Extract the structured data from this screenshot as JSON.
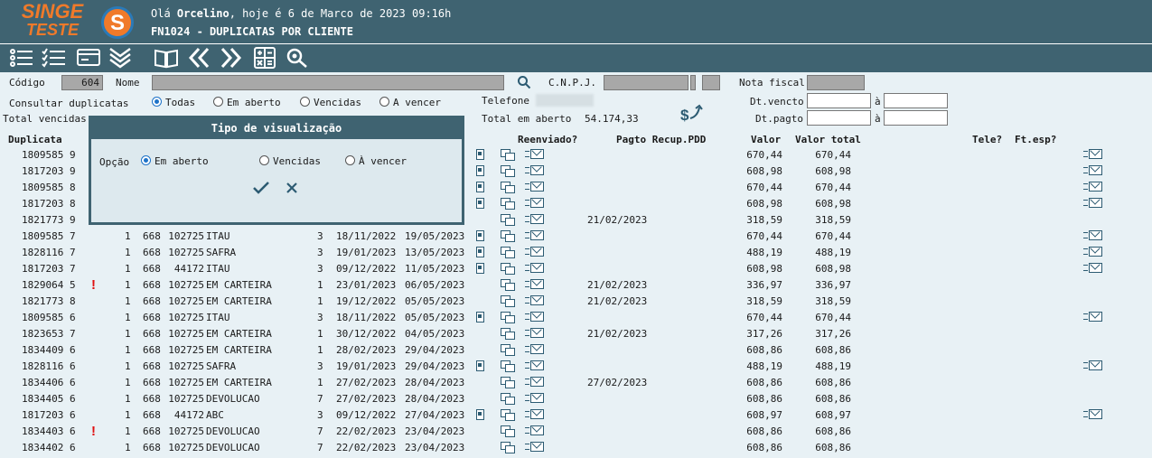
{
  "header": {
    "logo_main": "SINGE",
    "logo_sub": "TESTE",
    "logo_letter": "S",
    "greeting_prefix": "Olá ",
    "user": "Orcelino",
    "greeting_suffix": ", hoje é 6 de Marco de 2023 09:16h",
    "screen_title": "FN1024 - DUPLICATAS POR CLIENTE"
  },
  "toolbar_icons": [
    "list-icon",
    "checklist-icon",
    "card-icon",
    "chevrons-down-icon",
    "book-icon",
    "previous-icon",
    "next-icon",
    "calculator-icon",
    "search-icon"
  ],
  "filters": {
    "codigo_label": "Código",
    "codigo_value": "604",
    "nome_label": "Nome",
    "cnpj_label": "C.N.P.J.",
    "nota_fiscal_label": "Nota fiscal",
    "consultar_label": "Consultar duplicatas",
    "opts": [
      "Todas",
      "Em aberto",
      "Vencidas",
      "A vencer"
    ],
    "selected": "Todas",
    "telefone_label": "Telefone",
    "dt_vencto_label": "Dt.vencto",
    "dt_pagto_label": "Dt.pagto",
    "a_label": "à",
    "total_vencidas_label": "Total vencidas",
    "total_aberto_label": "Total em aberto",
    "total_aberto_value": "54.174,33"
  },
  "columns": {
    "duplicata": "Duplicata",
    "reenviado": "Reenviado?",
    "pagto": "Pagto Recup.PDD",
    "valor": "Valor",
    "valor_total": "Valor total",
    "tele": "Tele?",
    "ft_esp": "Ft.esp?"
  },
  "modal": {
    "title": "Tipo de visualização",
    "opcao_label": "Opção",
    "options": [
      "Em aberto",
      "Vencidas",
      "À vencer"
    ],
    "selected": "Em aberto"
  },
  "rows": [
    {
      "dup": "1809585 9",
      "a": "",
      "b": "",
      "c": "",
      "d": "",
      "e": "",
      "f": "",
      "g": "",
      "doc": true,
      "pagto": "",
      "valor": "670,44",
      "total": "670,44",
      "ft": true,
      "alert": false
    },
    {
      "dup": "1817203 9",
      "a": "",
      "b": "",
      "c": "",
      "d": "",
      "e": "",
      "f": "",
      "g": "",
      "doc": true,
      "pagto": "",
      "valor": "608,98",
      "total": "608,98",
      "ft": true,
      "alert": false
    },
    {
      "dup": "1809585 8",
      "a": "",
      "b": "",
      "c": "",
      "d": "",
      "e": "",
      "f": "",
      "g": "",
      "doc": true,
      "pagto": "",
      "valor": "670,44",
      "total": "670,44",
      "ft": true,
      "alert": false
    },
    {
      "dup": "1817203 8",
      "a": "",
      "b": "",
      "c": "",
      "d": "",
      "e": "",
      "f": "",
      "g": "",
      "doc": true,
      "pagto": "",
      "valor": "608,98",
      "total": "608,98",
      "ft": true,
      "alert": false
    },
    {
      "dup": "1821773 9",
      "a": "",
      "b": "",
      "c": "",
      "d": "",
      "e": "",
      "f": "",
      "g": "",
      "doc": false,
      "pagto": "21/02/2023",
      "valor": "318,59",
      "total": "318,59",
      "ft": false,
      "alert": false
    },
    {
      "dup": "1809585 7",
      "a": "1",
      "b": "668",
      "c": "102725",
      "d": "ITAU",
      "e": "3",
      "f": "18/11/2022",
      "g": "19/05/2023",
      "doc": true,
      "pagto": "",
      "valor": "670,44",
      "total": "670,44",
      "ft": true,
      "alert": false
    },
    {
      "dup": "1828116 7",
      "a": "1",
      "b": "668",
      "c": "102725",
      "d": "SAFRA",
      "e": "3",
      "f": "19/01/2023",
      "g": "13/05/2023",
      "doc": true,
      "pagto": "",
      "valor": "488,19",
      "total": "488,19",
      "ft": true,
      "alert": false
    },
    {
      "dup": "1817203 7",
      "a": "1",
      "b": "668",
      "c": "44172",
      "d": "ITAU",
      "e": "3",
      "f": "09/12/2022",
      "g": "11/05/2023",
      "doc": true,
      "pagto": "",
      "valor": "608,98",
      "total": "608,98",
      "ft": true,
      "alert": false
    },
    {
      "dup": "1829064 5",
      "a": "1",
      "b": "668",
      "c": "102725",
      "d": "EM CARTEIRA",
      "e": "1",
      "f": "23/01/2023",
      "g": "06/05/2023",
      "doc": false,
      "pagto": "21/02/2023",
      "valor": "336,97",
      "total": "336,97",
      "ft": false,
      "alert": true
    },
    {
      "dup": "1821773 8",
      "a": "1",
      "b": "668",
      "c": "102725",
      "d": "EM CARTEIRA",
      "e": "1",
      "f": "19/12/2022",
      "g": "05/05/2023",
      "doc": false,
      "pagto": "21/02/2023",
      "valor": "318,59",
      "total": "318,59",
      "ft": false,
      "alert": false
    },
    {
      "dup": "1809585 6",
      "a": "1",
      "b": "668",
      "c": "102725",
      "d": "ITAU",
      "e": "3",
      "f": "18/11/2022",
      "g": "05/05/2023",
      "doc": true,
      "pagto": "",
      "valor": "670,44",
      "total": "670,44",
      "ft": true,
      "alert": false
    },
    {
      "dup": "1823653 7",
      "a": "1",
      "b": "668",
      "c": "102725",
      "d": "EM CARTEIRA",
      "e": "1",
      "f": "30/12/2022",
      "g": "04/05/2023",
      "doc": false,
      "pagto": "21/02/2023",
      "valor": "317,26",
      "total": "317,26",
      "ft": false,
      "alert": false
    },
    {
      "dup": "1834409 6",
      "a": "1",
      "b": "668",
      "c": "102725",
      "d": "EM CARTEIRA",
      "e": "1",
      "f": "28/02/2023",
      "g": "29/04/2023",
      "doc": false,
      "pagto": "",
      "valor": "608,86",
      "total": "608,86",
      "ft": false,
      "alert": false
    },
    {
      "dup": "1828116 6",
      "a": "1",
      "b": "668",
      "c": "102725",
      "d": "SAFRA",
      "e": "3",
      "f": "19/01/2023",
      "g": "29/04/2023",
      "doc": true,
      "pagto": "",
      "valor": "488,19",
      "total": "488,19",
      "ft": true,
      "alert": false
    },
    {
      "dup": "1834406 6",
      "a": "1",
      "b": "668",
      "c": "102725",
      "d": "EM CARTEIRA",
      "e": "1",
      "f": "27/02/2023",
      "g": "28/04/2023",
      "doc": false,
      "pagto": "27/02/2023",
      "valor": "608,86",
      "total": "608,86",
      "ft": false,
      "alert": false
    },
    {
      "dup": "1834405 6",
      "a": "1",
      "b": "668",
      "c": "102725",
      "d": "DEVOLUCAO",
      "e": "7",
      "f": "27/02/2023",
      "g": "28/04/2023",
      "doc": false,
      "pagto": "",
      "valor": "608,86",
      "total": "608,86",
      "ft": false,
      "alert": false
    },
    {
      "dup": "1817203 6",
      "a": "1",
      "b": "668",
      "c": "44172",
      "d": "ABC",
      "e": "3",
      "f": "09/12/2022",
      "g": "27/04/2023",
      "doc": true,
      "pagto": "",
      "valor": "608,97",
      "total": "608,97",
      "ft": true,
      "alert": false
    },
    {
      "dup": "1834403 6",
      "a": "1",
      "b": "668",
      "c": "102725",
      "d": "DEVOLUCAO",
      "e": "7",
      "f": "22/02/2023",
      "g": "23/04/2023",
      "doc": false,
      "pagto": "",
      "valor": "608,86",
      "total": "608,86",
      "ft": false,
      "alert": true
    },
    {
      "dup": "1834402 6",
      "a": "1",
      "b": "668",
      "c": "102725",
      "d": "DEVOLUCAO",
      "e": "7",
      "f": "22/02/2023",
      "g": "23/04/2023",
      "doc": false,
      "pagto": "",
      "valor": "608,86",
      "total": "608,86",
      "ft": false,
      "alert": false
    }
  ]
}
